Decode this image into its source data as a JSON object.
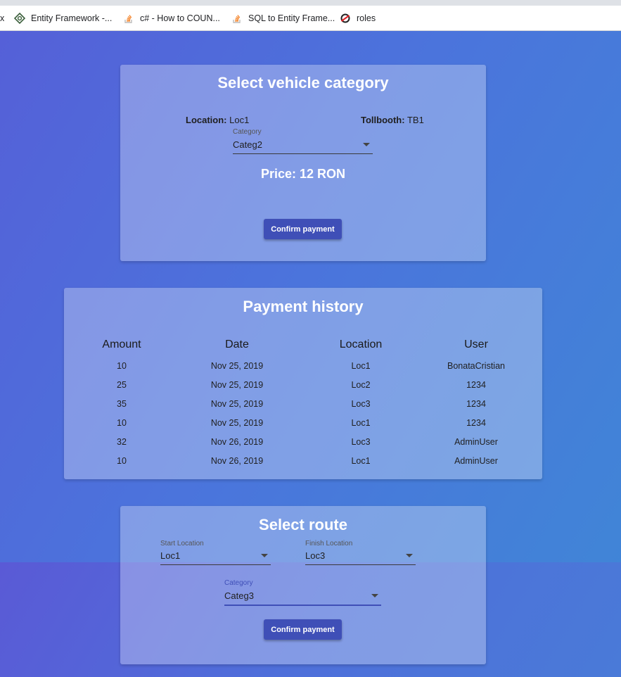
{
  "bookmarks": {
    "partial": "x",
    "items": [
      {
        "label": "Entity Framework -...",
        "icon": "entity-framework-icon"
      },
      {
        "label": "c# - How to COUN...",
        "icon": "stackoverflow-icon"
      },
      {
        "label": "SQL to Entity Frame...",
        "icon": "stackoverflow-icon"
      },
      {
        "label": "roles",
        "icon": "roles-site-icon"
      }
    ]
  },
  "vehicle_category": {
    "title": "Select vehicle category",
    "location_label": "Location:",
    "location_value": "Loc1",
    "tollbooth_label": "Tollbooth:",
    "tollbooth_value": "TB1",
    "category_label": "Category",
    "category_value": "Categ2",
    "price": "Price: 12 RON",
    "confirm_label": "Confirm payment"
  },
  "payment_history": {
    "title": "Payment history",
    "columns": [
      "Amount",
      "Date",
      "Location",
      "User"
    ],
    "rows": [
      [
        "10",
        "Nov 25, 2019",
        "Loc1",
        "BonataCristian"
      ],
      [
        "25",
        "Nov 25, 2019",
        "Loc2",
        "1234"
      ],
      [
        "35",
        "Nov 25, 2019",
        "Loc3",
        "1234"
      ],
      [
        "10",
        "Nov 25, 2019",
        "Loc1",
        "1234"
      ],
      [
        "32",
        "Nov 26, 2019",
        "Loc3",
        "AdminUser"
      ],
      [
        "10",
        "Nov 26, 2019",
        "Loc1",
        "AdminUser"
      ]
    ]
  },
  "route": {
    "title": "Select route",
    "start_label": "Start Location",
    "start_value": "Loc1",
    "finish_label": "Finish Location",
    "finish_value": "Loc3",
    "category_label": "Category",
    "category_value": "Categ3",
    "confirm_label": "Confirm payment"
  },
  "colors": {
    "button": "#3f4fb7",
    "background_start": "#5560d8",
    "background_end": "#3f87d6"
  }
}
